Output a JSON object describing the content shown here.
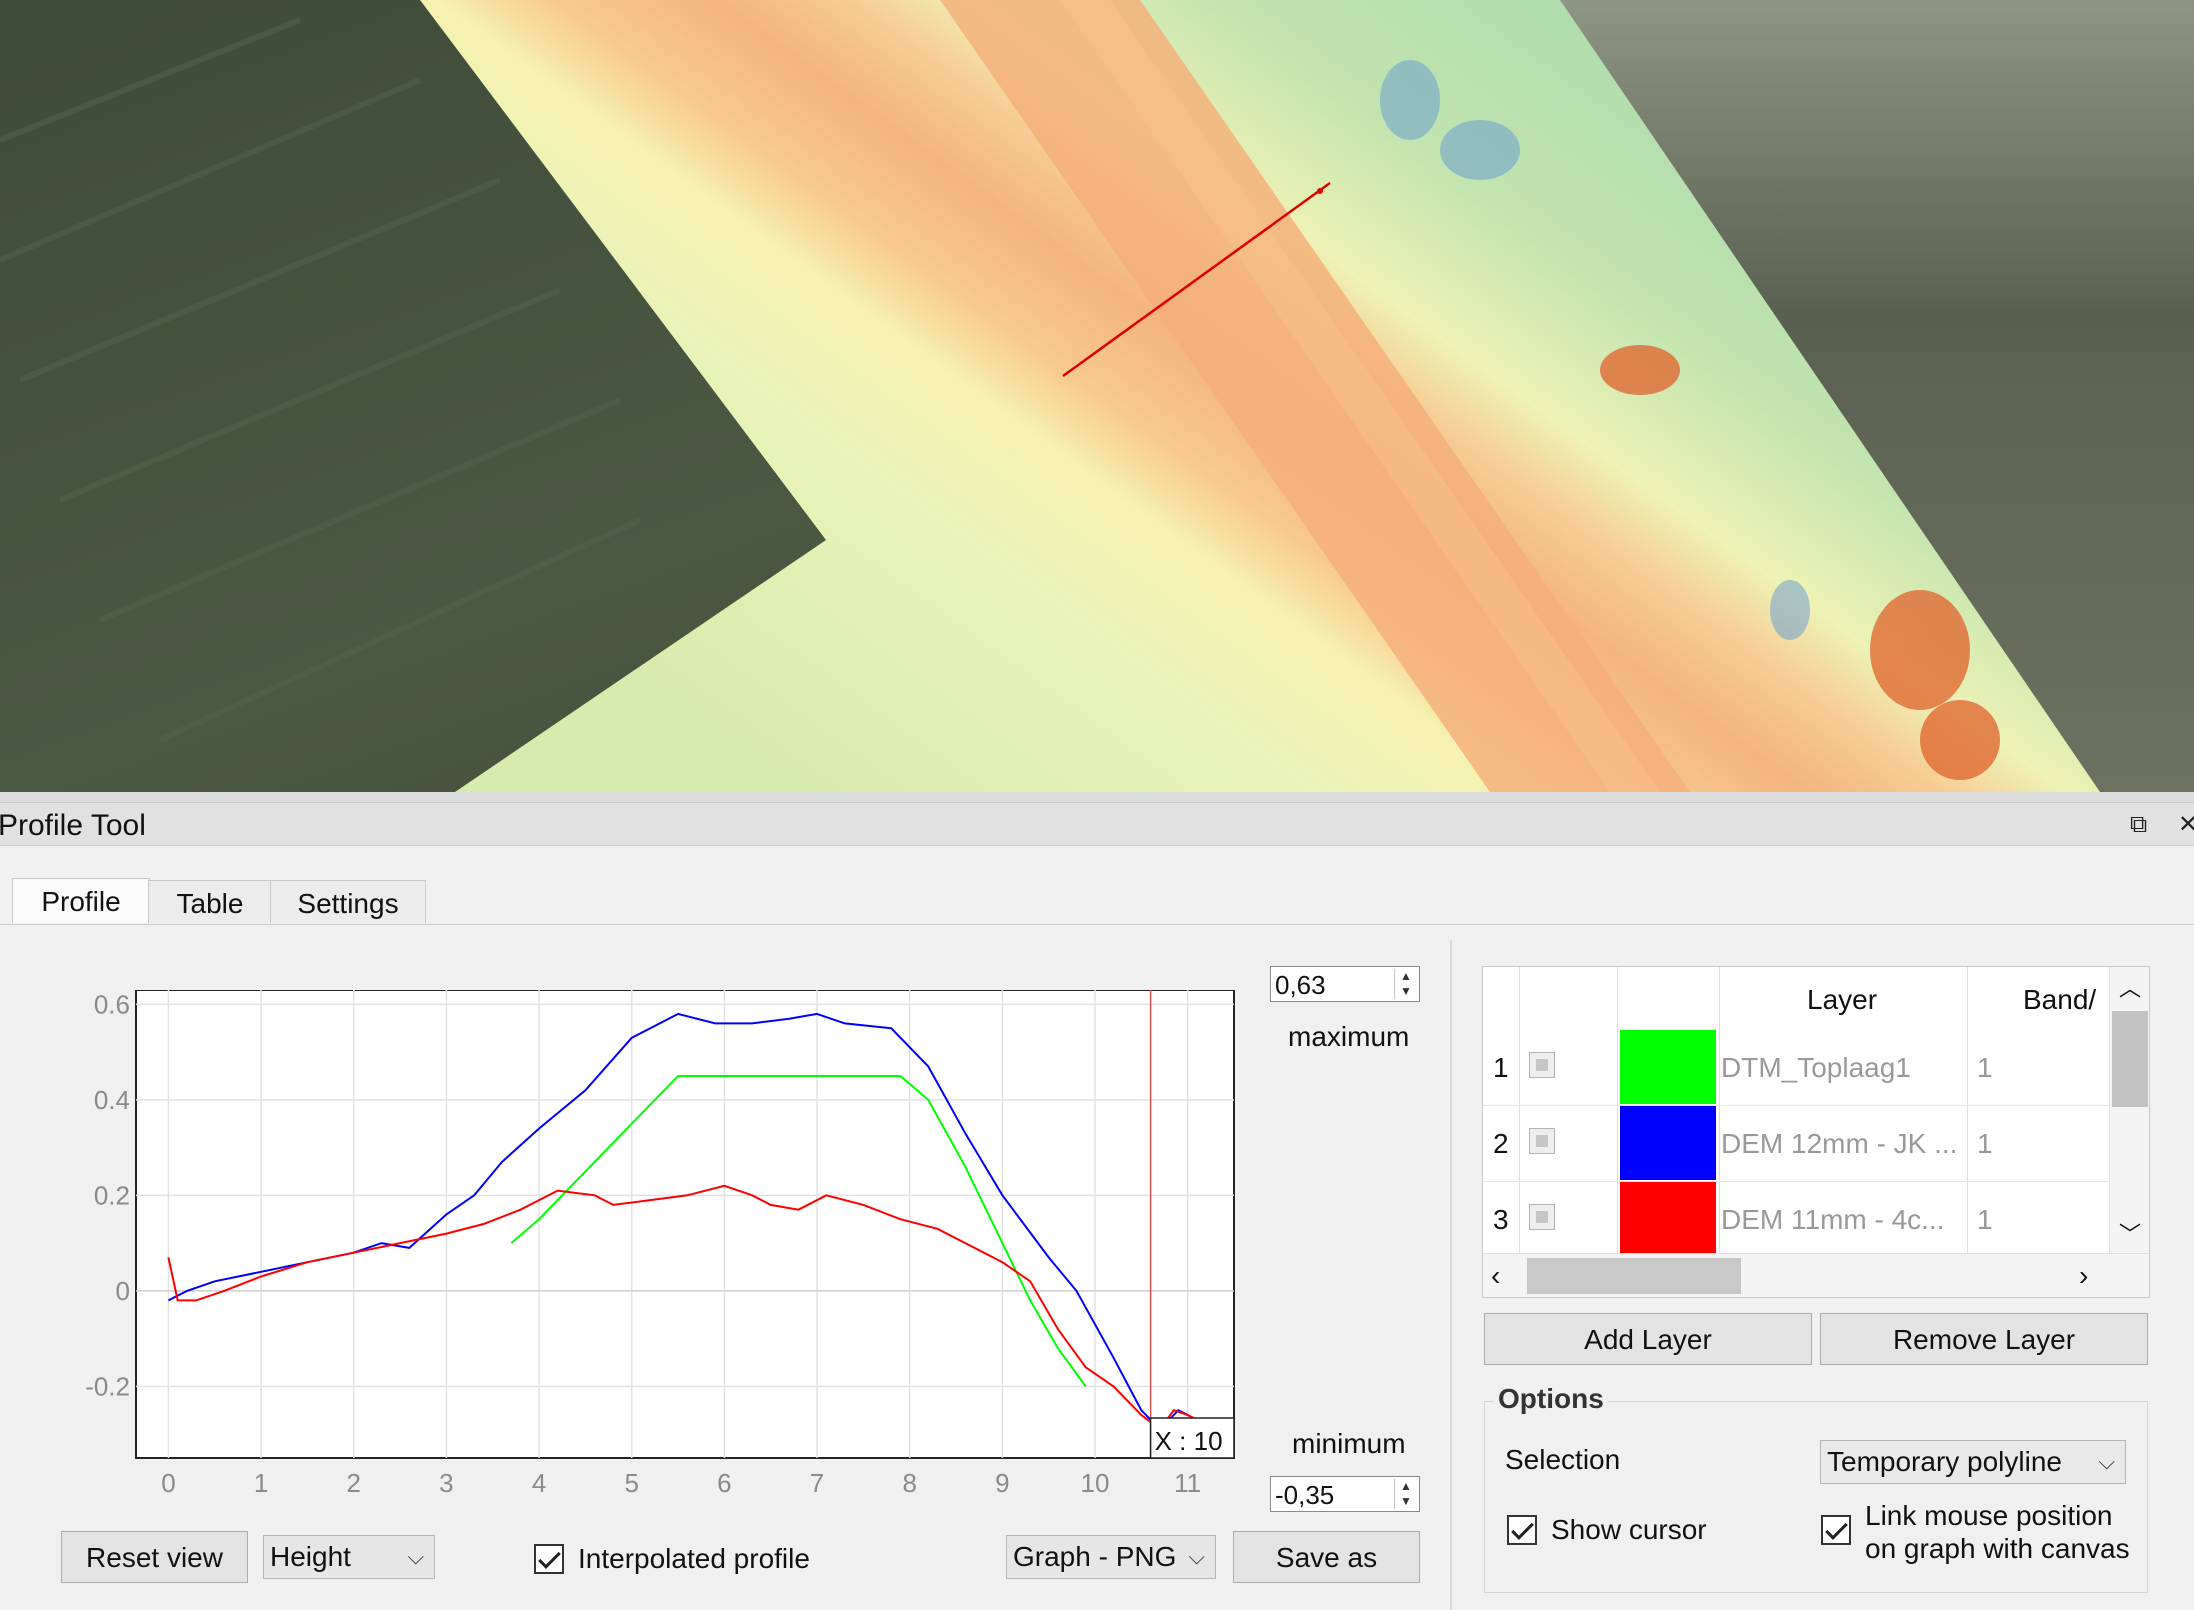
{
  "dock": {
    "title": "Profile Tool"
  },
  "tabs": [
    {
      "label": "Profile",
      "active": true
    },
    {
      "label": "Table",
      "active": false
    },
    {
      "label": "Settings",
      "active": false
    }
  ],
  "plot": {
    "maximum_value": "0,63",
    "maximum_label": "maximum",
    "minimum_value": "-0,35",
    "minimum_label": "minimum",
    "cursor_readout": "X : 10"
  },
  "controls": {
    "reset_view_label": "Reset view",
    "height_combo_value": "Height",
    "interpolated_profile_label": "Interpolated profile",
    "interpolated_profile_checked": true,
    "export_format_value": "Graph - PNG",
    "save_as_label": "Save as"
  },
  "layer_table": {
    "headers": {
      "layer": "Layer",
      "band": "Band/"
    },
    "rows": [
      {
        "num": "1",
        "color": "#00ff00",
        "name": "DTM_Toplaag1",
        "band": "1"
      },
      {
        "num": "2",
        "color": "#0000ff",
        "name": "DEM 12mm - JK ...",
        "band": "1"
      },
      {
        "num": "3",
        "color": "#ff0000",
        "name": "DEM 11mm - 4c...",
        "band": "1"
      }
    ]
  },
  "layer_buttons": {
    "add_label": "Add Layer",
    "remove_label": "Remove Layer"
  },
  "options": {
    "title": "Options",
    "selection_label": "Selection",
    "selection_value": "Temporary polyline",
    "show_cursor_label": "Show cursor",
    "show_cursor_checked": true,
    "link_mouse_line1": "Link mouse position",
    "link_mouse_line2": "on graph with canvas",
    "link_mouse_checked": true
  },
  "chart_data": {
    "type": "line",
    "xlim": [
      -0.35,
      11.5
    ],
    "ylim": [
      -0.35,
      0.63
    ],
    "x_ticks": [
      "0",
      "1",
      "2",
      "3",
      "4",
      "5",
      "6",
      "7",
      "8",
      "9",
      "10",
      "11"
    ],
    "y_ticks": [
      "0.6",
      "0.4",
      "0.2",
      "0",
      "-0.2"
    ],
    "cursor_x": 10.6,
    "grid": true,
    "series": [
      {
        "color": "#0000ff",
        "points": [
          [
            0,
            -0.02
          ],
          [
            0.2,
            0.0
          ],
          [
            0.5,
            0.02
          ],
          [
            1,
            0.04
          ],
          [
            1.5,
            0.06
          ],
          [
            2,
            0.08
          ],
          [
            2.3,
            0.1
          ],
          [
            2.6,
            0.09
          ],
          [
            3,
            0.16
          ],
          [
            3.3,
            0.2
          ],
          [
            3.6,
            0.27
          ],
          [
            4,
            0.34
          ],
          [
            4.5,
            0.42
          ],
          [
            5,
            0.53
          ],
          [
            5.5,
            0.58
          ],
          [
            5.9,
            0.56
          ],
          [
            6.3,
            0.56
          ],
          [
            6.7,
            0.57
          ],
          [
            7,
            0.58
          ],
          [
            7.3,
            0.56
          ],
          [
            7.8,
            0.55
          ],
          [
            8.2,
            0.47
          ],
          [
            8.6,
            0.33
          ],
          [
            9,
            0.2
          ],
          [
            9.5,
            0.07
          ],
          [
            9.8,
            0.0
          ],
          [
            10.2,
            -0.14
          ],
          [
            10.5,
            -0.25
          ],
          [
            10.7,
            -0.29
          ],
          [
            10.9,
            -0.25
          ],
          [
            11.1,
            -0.27
          ]
        ]
      },
      {
        "color": "#00ff00",
        "points": [
          [
            3.7,
            0.1
          ],
          [
            4,
            0.15
          ],
          [
            4.5,
            0.25
          ],
          [
            5,
            0.35
          ],
          [
            5.5,
            0.45
          ],
          [
            6,
            0.45
          ],
          [
            7,
            0.45
          ],
          [
            7.9,
            0.45
          ],
          [
            8.2,
            0.4
          ],
          [
            8.6,
            0.26
          ],
          [
            9,
            0.1
          ],
          [
            9.3,
            -0.02
          ],
          [
            9.6,
            -0.12
          ],
          [
            9.9,
            -0.2
          ]
        ]
      },
      {
        "color": "#ff0000",
        "points": [
          [
            0,
            0.07
          ],
          [
            0.1,
            -0.02
          ],
          [
            0.3,
            -0.02
          ],
          [
            0.6,
            0.0
          ],
          [
            1,
            0.03
          ],
          [
            1.5,
            0.06
          ],
          [
            2,
            0.08
          ],
          [
            2.5,
            0.1
          ],
          [
            3,
            0.12
          ],
          [
            3.4,
            0.14
          ],
          [
            3.8,
            0.17
          ],
          [
            4.2,
            0.21
          ],
          [
            4.6,
            0.2
          ],
          [
            4.8,
            0.18
          ],
          [
            5.2,
            0.19
          ],
          [
            5.6,
            0.2
          ],
          [
            6,
            0.22
          ],
          [
            6.3,
            0.2
          ],
          [
            6.5,
            0.18
          ],
          [
            6.8,
            0.17
          ],
          [
            7.1,
            0.2
          ],
          [
            7.5,
            0.18
          ],
          [
            7.9,
            0.15
          ],
          [
            8.3,
            0.13
          ],
          [
            8.6,
            0.1
          ],
          [
            9,
            0.06
          ],
          [
            9.3,
            0.02
          ],
          [
            9.6,
            -0.08
          ],
          [
            9.9,
            -0.16
          ],
          [
            10.2,
            -0.2
          ],
          [
            10.5,
            -0.26
          ],
          [
            10.7,
            -0.29
          ],
          [
            10.85,
            -0.25
          ],
          [
            11.0,
            -0.26
          ],
          [
            11.1,
            -0.27
          ]
        ]
      }
    ]
  }
}
